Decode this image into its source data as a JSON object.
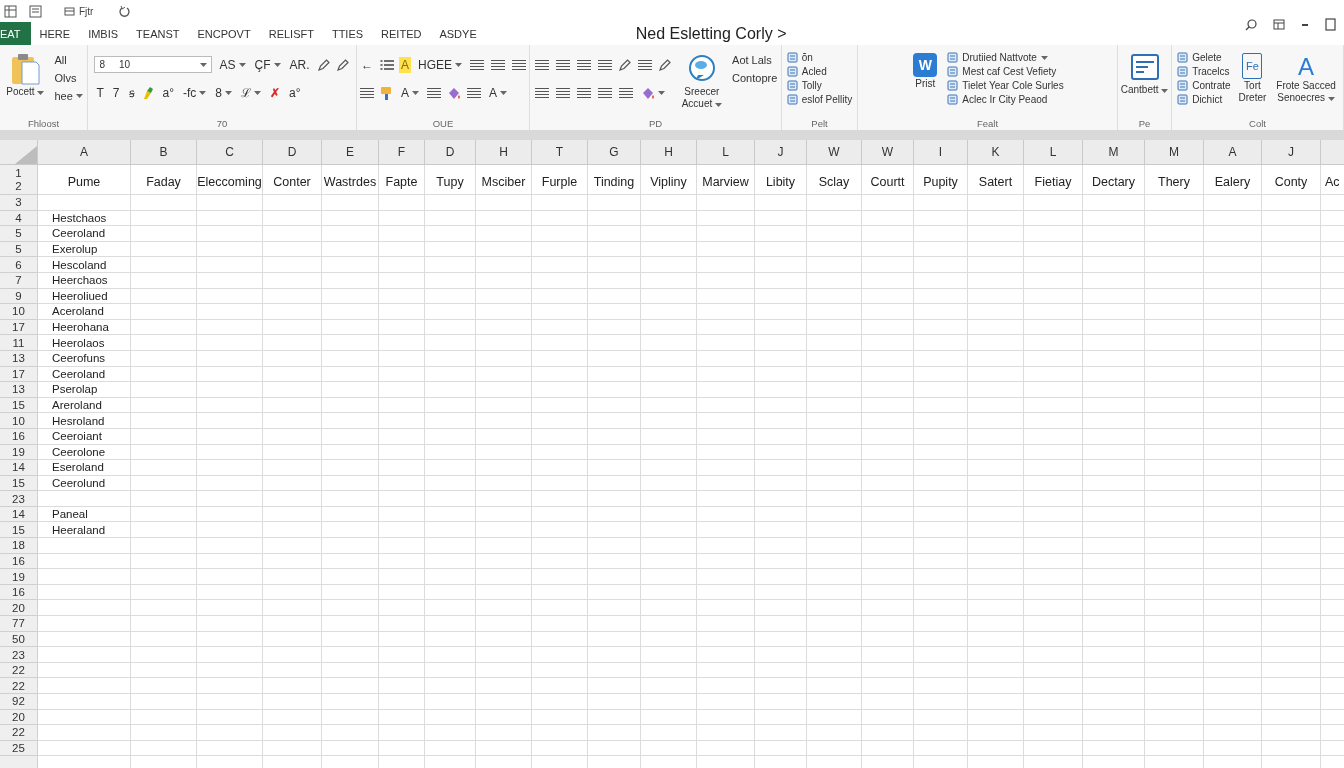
{
  "quick_access": {
    "label": "Fjtr"
  },
  "tabs": [
    {
      "label": "EAT",
      "selected": true
    },
    {
      "label": "HERE",
      "selected": false
    },
    {
      "label": "IMBIS",
      "selected": false
    },
    {
      "label": "TEANST",
      "selected": false
    },
    {
      "label": "ENCPOVT",
      "selected": false
    },
    {
      "label": "RELISFT",
      "selected": false
    },
    {
      "label": "TTIES",
      "selected": false
    },
    {
      "label": "REITED",
      "selected": false
    },
    {
      "label": "ASDYE",
      "selected": false
    }
  ],
  "title": "Ned Esletting Corly >",
  "ribbon": {
    "groups": [
      {
        "label": "Fhloost",
        "columns": [
          {
            "kind": "paste",
            "lines": [
              "Pocett"
            ],
            "menu": true
          },
          {
            "kind": "plain",
            "items": [
              {
                "text": "All"
              },
              {
                "text": "Olvs"
              },
              {
                "text": "hee",
                "menu": true
              }
            ]
          }
        ]
      },
      {
        "label": "70",
        "columns": [
          {
            "kind": "tools",
            "strips": [
              {
                "tools": [
                  {
                    "kind": "font",
                    "texts": [
                      "8",
                      "10"
                    ],
                    "menu": true
                  },
                  {
                    "kind": "glyph",
                    "text": "AS",
                    "menu": true
                  },
                  {
                    "kind": "glyph",
                    "text": "ÇF",
                    "menu": true
                  },
                  {
                    "kind": "glyph",
                    "text": "AR."
                  },
                  {
                    "kind": "pen"
                  },
                  {
                    "kind": "pen"
                  }
                ]
              },
              {
                "tools": [
                  {
                    "kind": "glyph",
                    "text": "T"
                  },
                  {
                    "kind": "glyph",
                    "text": "7"
                  },
                  {
                    "kind": "glyph",
                    "text": "ꞩ"
                  },
                  {
                    "kind": "marker"
                  },
                  {
                    "kind": "glyph",
                    "text": "a°"
                  },
                  {
                    "kind": "glyph",
                    "text": "-fc",
                    "menu": true
                  },
                  {
                    "kind": "glyph",
                    "text": "8",
                    "menu": true
                  },
                  {
                    "kind": "glyph",
                    "text": "ℒ",
                    "menu": true
                  },
                  {
                    "kind": "glyph",
                    "text": "✗",
                    "color": "#d92b2b"
                  },
                  {
                    "kind": "glyph",
                    "text": "a°"
                  }
                ]
              }
            ]
          }
        ]
      },
      {
        "label": "OUE",
        "columns": [
          {
            "kind": "tools",
            "strips": [
              {
                "tools": [
                  {
                    "kind": "glyph",
                    "text": "←"
                  },
                  {
                    "kind": "list"
                  },
                  {
                    "kind": "highlight",
                    "text": "A"
                  },
                  {
                    "kind": "glyph",
                    "text": "HGEE",
                    "menu": true
                  },
                  {
                    "kind": "lines"
                  },
                  {
                    "kind": "lines"
                  },
                  {
                    "kind": "lines"
                  }
                ]
              },
              {
                "tools": [
                  {
                    "kind": "lines"
                  },
                  {
                    "kind": "paint"
                  },
                  {
                    "kind": "glyph",
                    "text": "A",
                    "menu": true
                  },
                  {
                    "kind": "lines"
                  },
                  {
                    "kind": "bucket"
                  },
                  {
                    "kind": "lines"
                  },
                  {
                    "kind": "glyph",
                    "text": "A",
                    "menu": true
                  }
                ]
              }
            ]
          }
        ]
      },
      {
        "label": "PD",
        "columns": [
          {
            "kind": "tools",
            "strips": [
              {
                "tools": [
                  {
                    "kind": "lines"
                  },
                  {
                    "kind": "lines"
                  },
                  {
                    "kind": "lines"
                  },
                  {
                    "kind": "lines"
                  },
                  {
                    "kind": "pen"
                  },
                  {
                    "kind": "lines"
                  },
                  {
                    "kind": "pen"
                  }
                ]
              },
              {
                "tools": [
                  {
                    "kind": "lines"
                  },
                  {
                    "kind": "lines"
                  },
                  {
                    "kind": "lines"
                  },
                  {
                    "kind": "lines"
                  },
                  {
                    "kind": "lines"
                  },
                  {
                    "kind": "bucket",
                    "menu": true
                  }
                ]
              }
            ]
          },
          {
            "kind": "speaker",
            "lines": [
              "Sreecer",
              "Accuet"
            ],
            "menu": true
          },
          {
            "kind": "plain",
            "items": [
              {
                "text": "Aot Lals"
              },
              {
                "text": "Contopre"
              }
            ]
          }
        ]
      },
      {
        "label": "Pelt",
        "columns": [
          {
            "kind": "list",
            "items": [
              {
                "text": "ŏn"
              },
              {
                "text": "Acled"
              },
              {
                "text": "Tolly"
              },
              {
                "text": "eslof Pellity"
              }
            ]
          }
        ]
      },
      {
        "label": "Fealt",
        "columns": [
          {
            "kind": "word",
            "mark": "W",
            "lines": [
              "Prist"
            ]
          },
          {
            "kind": "list",
            "items": [
              {
                "text": "Drutiied Nattvote",
                "menu": true
              },
              {
                "text": "Mest caf Cest Vefiety"
              },
              {
                "text": "Tielet Year Cole Surles"
              },
              {
                "text": "Aclec Ir City Peaod"
              }
            ]
          }
        ]
      },
      {
        "label": "Pe",
        "columns": [
          {
            "kind": "board",
            "lines": [
              "Cantbett"
            ],
            "menu": true
          }
        ]
      },
      {
        "label": "Colt",
        "columns": [
          {
            "kind": "list",
            "items": [
              {
                "text": "Gelete"
              },
              {
                "text": "Tracelcs"
              },
              {
                "text": "Contrate"
              },
              {
                "text": "Dichict"
              }
            ]
          },
          {
            "kind": "file",
            "mark": "Fe",
            "lines": [
              "Tort",
              "Dreter"
            ]
          },
          {
            "kind": "fontgrow",
            "mark": "A",
            "lines": [
              "Frote Sacced",
              "Senoecres"
            ],
            "menu": true
          }
        ]
      }
    ]
  },
  "sheet": {
    "columns": [
      "A",
      "B",
      "C",
      "D",
      "E",
      "F",
      "D",
      "H",
      "T",
      "G",
      "H",
      "L",
      "J",
      "W",
      "W",
      "I",
      "K",
      "L",
      "M",
      "M",
      "A",
      "J"
    ],
    "header_row": {
      "numbers": [
        "1",
        "2"
      ],
      "cells": [
        "Pume",
        "Faday",
        "Eleccoming",
        "Conter",
        "Wastrdes",
        "Fapte",
        "Tupy",
        "Msciber",
        "Furple",
        "Tinding",
        "Vipliny",
        "Marview",
        "Libity",
        "Sclay",
        "Courtt",
        "Pupity",
        "Satert",
        "Fietiay",
        "Dectary",
        "Thery",
        "Ealery",
        "Conty",
        "Ac"
      ]
    },
    "rows": [
      {
        "number": "3"
      },
      {
        "number": "4",
        "cells": [
          "Hestchaos"
        ]
      },
      {
        "number": "5",
        "cells": [
          "Ceeroland"
        ]
      },
      {
        "number": "5",
        "cells": [
          "Exerolup"
        ]
      },
      {
        "number": "6",
        "cells": [
          "Hescoland"
        ]
      },
      {
        "number": "7",
        "cells": [
          "Heerchaos"
        ]
      },
      {
        "number": "9",
        "cells": [
          "Heeroliued"
        ]
      },
      {
        "number": "10",
        "cells": [
          "Aceroland"
        ]
      },
      {
        "number": "17",
        "cells": [
          "Heerohana"
        ]
      },
      {
        "number": "11",
        "cells": [
          "Heerolaos"
        ]
      },
      {
        "number": "13",
        "cells": [
          "Ceerofuns"
        ]
      },
      {
        "number": "17",
        "cells": [
          "Ceeroland"
        ]
      },
      {
        "number": "13",
        "cells": [
          "Pserolap"
        ]
      },
      {
        "number": "15",
        "cells": [
          "Areroland"
        ]
      },
      {
        "number": "10",
        "cells": [
          "Hesroland"
        ]
      },
      {
        "number": "16",
        "cells": [
          "Ceeroiant"
        ]
      },
      {
        "number": "19",
        "cells": [
          "Ceerolone"
        ]
      },
      {
        "number": "14",
        "cells": [
          "Eseroland"
        ]
      },
      {
        "number": "15",
        "cells": [
          "Ceerolund"
        ]
      },
      {
        "number": "23"
      },
      {
        "number": "14",
        "cells": [
          "Paneal"
        ]
      },
      {
        "number": "15",
        "cells": [
          "Heeraland"
        ]
      },
      {
        "number": "18"
      },
      {
        "number": "16"
      },
      {
        "number": "19"
      },
      {
        "number": "16"
      },
      {
        "number": "20"
      },
      {
        "number": "77"
      },
      {
        "number": "50"
      },
      {
        "number": "23"
      },
      {
        "number": "22"
      },
      {
        "number": "22"
      },
      {
        "number": "92"
      },
      {
        "number": "20"
      },
      {
        "number": "22"
      },
      {
        "number": "25"
      }
    ]
  }
}
